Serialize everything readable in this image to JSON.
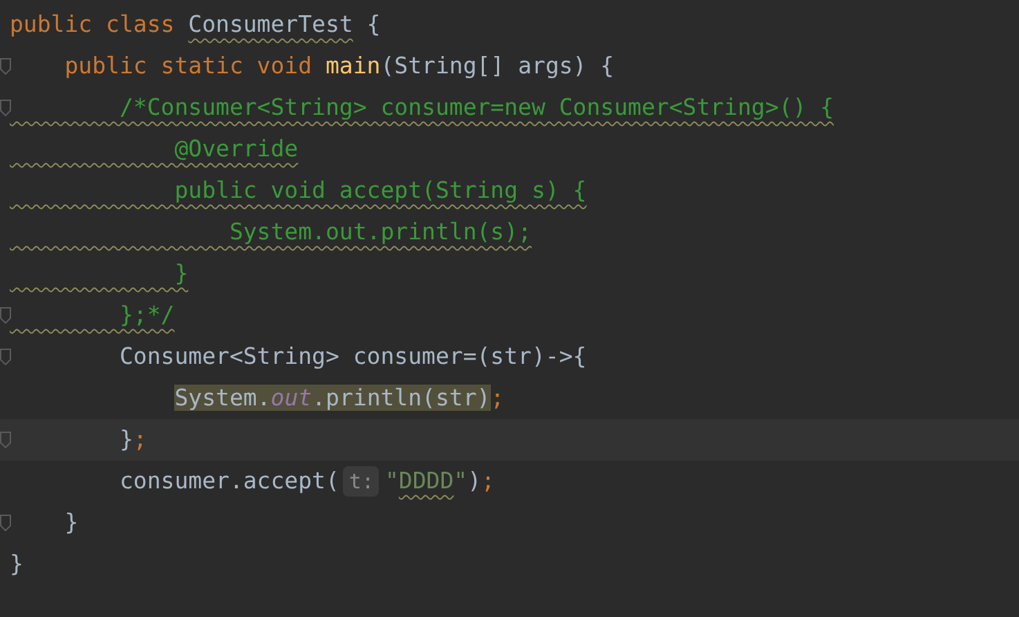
{
  "editor": {
    "lines": [
      {
        "fold": false,
        "current": false,
        "tokens": [
          {
            "kind": "keyword",
            "text": "public class "
          },
          {
            "kind": "plain",
            "text": "ConsumerTest",
            "squiggly": true
          },
          {
            "kind": "plain",
            "text": " {"
          }
        ]
      },
      {
        "fold": true,
        "current": false,
        "tokens": [
          {
            "kind": "keyword",
            "text": "    public static void "
          },
          {
            "kind": "method",
            "text": "main"
          },
          {
            "kind": "plain",
            "text": "(String[] args) {"
          }
        ]
      },
      {
        "fold": true,
        "current": false,
        "tokens": [
          {
            "kind": "comment",
            "text": "        /*Consumer<String> consumer=new Consumer<String>() {",
            "squiggly": true
          }
        ]
      },
      {
        "fold": false,
        "current": false,
        "tokens": [
          {
            "kind": "comment",
            "text": "            @Override",
            "squiggly": true
          }
        ]
      },
      {
        "fold": false,
        "current": false,
        "tokens": [
          {
            "kind": "comment",
            "text": "            public void accept(String s) {",
            "squiggly": true
          }
        ]
      },
      {
        "fold": false,
        "current": false,
        "tokens": [
          {
            "kind": "comment",
            "text": "                System.out.println(s);",
            "squiggly": true
          }
        ]
      },
      {
        "fold": false,
        "current": false,
        "tokens": [
          {
            "kind": "comment",
            "text": "            }",
            "squiggly": true
          }
        ]
      },
      {
        "fold": true,
        "current": false,
        "tokens": [
          {
            "kind": "comment",
            "text": "        };*/",
            "squiggly": true
          }
        ]
      },
      {
        "fold": true,
        "current": false,
        "tokens": [
          {
            "kind": "plain",
            "text": "        Consumer<String> consumer=(str)->"
          },
          {
            "kind": "brace",
            "text": "{"
          }
        ]
      },
      {
        "fold": false,
        "current": false,
        "tokens": [
          {
            "kind": "plain",
            "text": "            System.",
            "highlighted": true
          },
          {
            "kind": "field",
            "text": "out",
            "highlighted": true
          },
          {
            "kind": "plain",
            "text": ".println(str)",
            "highlighted": true
          },
          {
            "kind": "keyword",
            "text": ";",
            "highlighted": false
          }
        ]
      },
      {
        "fold": true,
        "current": true,
        "tokens": [
          {
            "kind": "plain",
            "text": "        }"
          },
          {
            "kind": "keyword",
            "text": ";"
          }
        ]
      },
      {
        "fold": false,
        "current": false,
        "tokens": [
          {
            "kind": "plain",
            "text": "        consumer.accept("
          },
          {
            "kind": "hint",
            "text": "t:"
          },
          {
            "kind": "string",
            "text": "\""
          },
          {
            "kind": "string",
            "text": "DDDD",
            "squiggly": true
          },
          {
            "kind": "string",
            "text": "\""
          },
          {
            "kind": "plain",
            "text": ")"
          },
          {
            "kind": "keyword",
            "text": ";"
          }
        ]
      },
      {
        "fold": true,
        "current": false,
        "tokens": [
          {
            "kind": "plain",
            "text": "    }"
          }
        ]
      },
      {
        "fold": false,
        "current": false,
        "tokens": [
          {
            "kind": "plain",
            "text": "}"
          }
        ]
      }
    ]
  }
}
